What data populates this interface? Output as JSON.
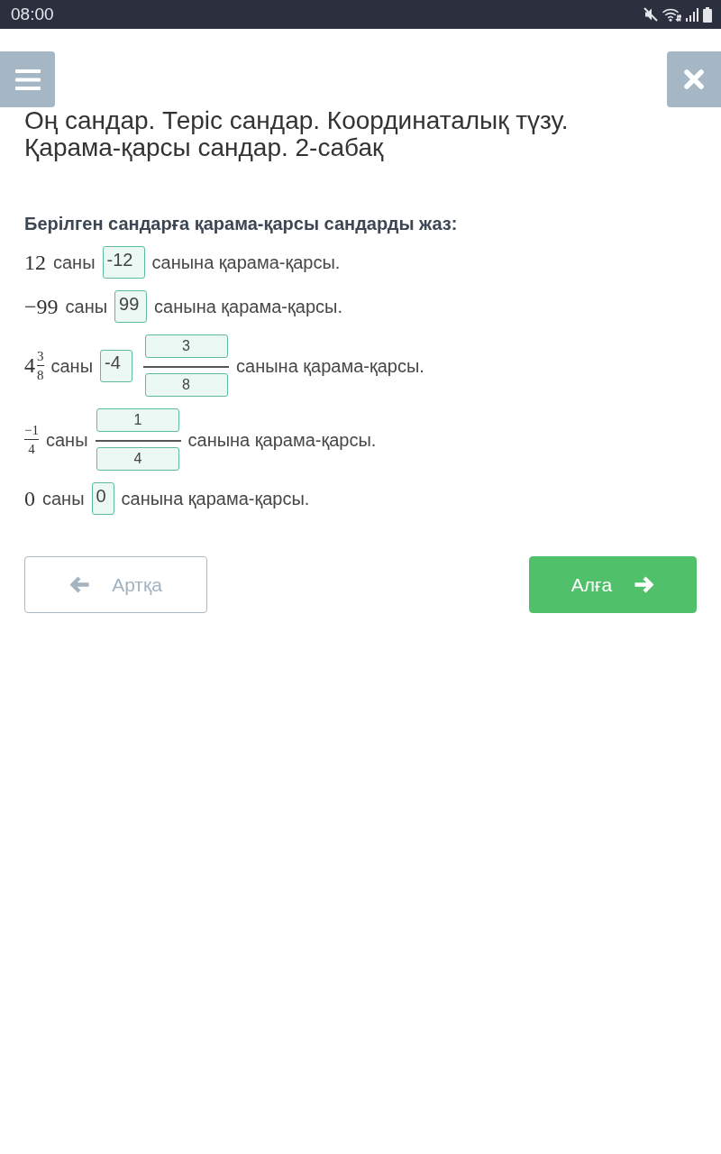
{
  "status_bar": {
    "time": "08:00"
  },
  "header": {
    "title": "Оң сандар. Теріс сандар. Координаталық түзу. Қарама-қарсы сандар. 2-сабақ"
  },
  "question": {
    "prompt": "Берілген сандарға қарама-қарсы сандарды жаз:",
    "rows": [
      {
        "given": {
          "kind": "number",
          "text": "12"
        },
        "word": "саны",
        "answer": {
          "kind": "number",
          "value": "-12"
        },
        "suffix": "санына қарама-қарсы."
      },
      {
        "given": {
          "kind": "number",
          "text": "−99"
        },
        "word": "саны",
        "answer": {
          "kind": "number",
          "value": "99"
        },
        "suffix": "санына қарама-қарсы."
      },
      {
        "given": {
          "kind": "mixed",
          "whole": "4",
          "numerator": "3",
          "denominator": "8"
        },
        "word": "саны",
        "answer": {
          "kind": "mixed",
          "whole": "-4",
          "numerator": "3",
          "denominator": "8"
        },
        "suffix": "санына қарама-қарсы."
      },
      {
        "given": {
          "kind": "fraction",
          "numerator": "−1",
          "denominator": "4"
        },
        "word": "саны",
        "answer": {
          "kind": "fraction",
          "numerator": "1",
          "denominator": "4"
        },
        "suffix": "санына қарама-қарсы."
      },
      {
        "given": {
          "kind": "number",
          "text": "0"
        },
        "word": "саны",
        "answer": {
          "kind": "number",
          "value": "0"
        },
        "suffix": "санына қарама-қарсы."
      }
    ]
  },
  "navigation": {
    "back": {
      "label": "Артқа",
      "disabled": true
    },
    "next": {
      "label": "Алға",
      "disabled": false
    }
  }
}
